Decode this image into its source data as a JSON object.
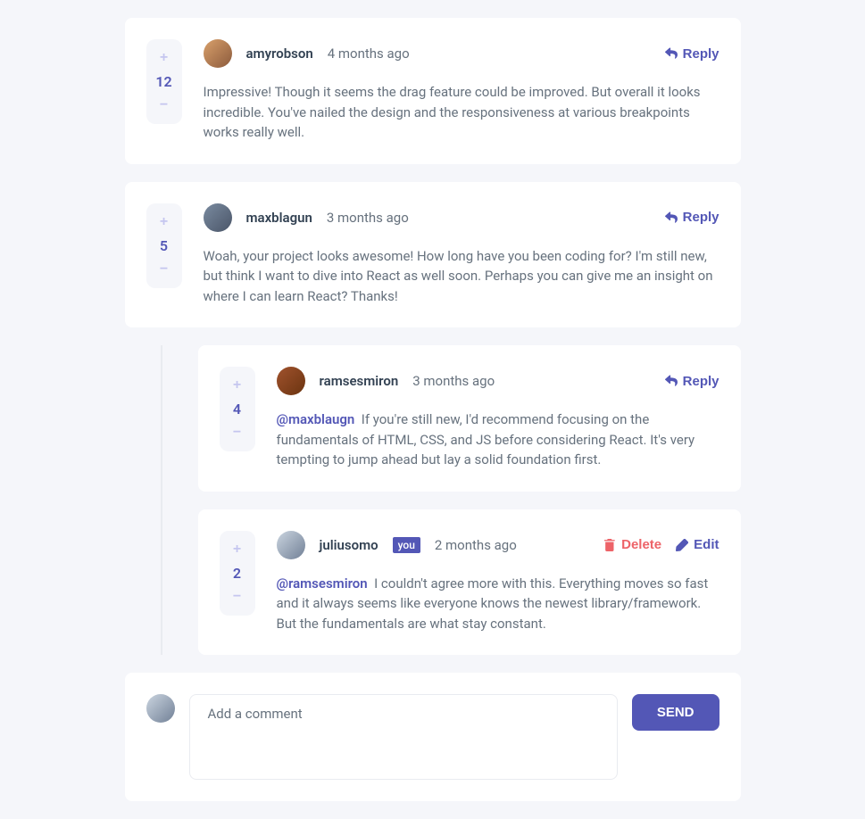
{
  "labels": {
    "reply": "Reply",
    "delete": "Delete",
    "edit": "Edit",
    "send": "SEND",
    "you": "you",
    "add_comment_placeholder": "Add a comment"
  },
  "currentUser": {
    "username": "juliusomo"
  },
  "comments": [
    {
      "score": 12,
      "username": "amyrobson",
      "timestamp": "4 months ago",
      "content": "Impressive! Though it seems the drag feature could be improved. But overall it looks incredible. You've nailed the design and the responsiveness at various breakpoints works really well.",
      "isCurrentUser": false,
      "replies": []
    },
    {
      "score": 5,
      "username": "maxblagun",
      "timestamp": "3 months ago",
      "content": "Woah, your project looks awesome! How long have you been coding for? I'm still new, but think I want to dive into React as well soon. Perhaps you can give me an insight on where I can learn React? Thanks!",
      "isCurrentUser": false,
      "replies": [
        {
          "score": 4,
          "username": "ramsesmiron",
          "timestamp": "3 months ago",
          "replyingTo": "@maxblaugn",
          "content": "If you're still new, I'd recommend focusing on the fundamentals of HTML, CSS, and JS before considering React. It's very tempting to jump ahead but lay a solid foundation first.",
          "isCurrentUser": false
        },
        {
          "score": 2,
          "username": "juliusomo",
          "timestamp": "2 months ago",
          "replyingTo": "@ramsesmiron",
          "content": "I couldn't agree more with this. Everything moves so fast and it always seems like everyone knows the newest library/framework. But the fundamentals are what stay constant.",
          "isCurrentUser": true
        }
      ]
    }
  ]
}
